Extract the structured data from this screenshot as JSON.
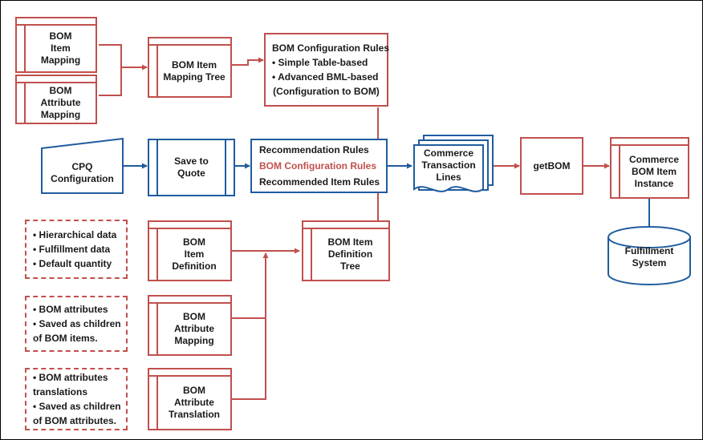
{
  "diagram": {
    "title": "BOM Configuration and Fulfillment Flow",
    "colors": {
      "red": "#C0504D",
      "blue": "#1F5C9E",
      "text": "#1A1A1A",
      "background": "#FFFFFF",
      "frame": "#000000"
    }
  },
  "nodes": {
    "bom_item_mapping": {
      "label": "BOM\nItem\nMapping",
      "shape": "table",
      "color": "red"
    },
    "bom_attribute_mapping_top": {
      "label": "BOM\nAttribute\nMapping",
      "shape": "table",
      "color": "red"
    },
    "bom_item_mapping_tree": {
      "label": "BOM Item\nMapping Tree",
      "shape": "table",
      "color": "red"
    },
    "bom_configuration_rules": {
      "shape": "textbox",
      "color": "red",
      "lines": [
        "BOM Configuration Rules",
        "• Simple Table-based",
        "• Advanced BML-based",
        "(Configuration to BOM)"
      ]
    },
    "cpq_configuration": {
      "label": "CPQ\nConfiguration",
      "shape": "trapezoid",
      "color": "blue"
    },
    "save_to_quote": {
      "label": "Save to\nQuote",
      "shape": "subprocess",
      "color": "blue"
    },
    "rules_box": {
      "shape": "rules-list",
      "color": "blue",
      "lines": [
        {
          "text": "Recommendation Rules",
          "accent": false
        },
        {
          "text": "BOM Configuration Rules",
          "accent": true
        },
        {
          "text": "Recommended Item Rules",
          "accent": false
        }
      ]
    },
    "commerce_transaction_lines": {
      "label": "Commerce\nTransaction\nLines",
      "shape": "multi-document",
      "color": "blue"
    },
    "get_bom": {
      "label": "getBOM",
      "shape": "rectangle",
      "color": "red"
    },
    "commerce_bom_item_instance": {
      "label": "Commerce\nBOM Item\nInstance",
      "shape": "table",
      "color": "red"
    },
    "fulfillment_system": {
      "label": "Fulfillment\nSystem",
      "shape": "cylinder",
      "color": "blue"
    },
    "note_hierarchical": {
      "shape": "dashed-textbox",
      "color": "red",
      "lines": [
        "• Hierarchical data",
        "• Fulfillment data",
        "• Default quantity"
      ]
    },
    "note_bom_attributes": {
      "shape": "dashed-textbox",
      "color": "red",
      "lines": [
        "• BOM attributes",
        "• Saved as children",
        "   of BOM items."
      ]
    },
    "note_bom_attr_translations": {
      "shape": "dashed-textbox",
      "color": "red",
      "lines": [
        "• BOM attributes",
        "   translations",
        "• Saved as children",
        "   of BOM attributes."
      ]
    },
    "bom_item_definition": {
      "label": "BOM\nItem\nDefinition",
      "shape": "table",
      "color": "red"
    },
    "bom_item_definition_tree": {
      "label": "BOM Item\nDefinition\nTree",
      "shape": "table",
      "color": "red"
    },
    "bom_attribute_mapping_bottom": {
      "label": "BOM\nAttribute\nMapping",
      "shape": "table",
      "color": "red"
    },
    "bom_attribute_translation": {
      "label": "BOM\nAttribute\nTranslation",
      "shape": "table",
      "color": "red"
    }
  }
}
